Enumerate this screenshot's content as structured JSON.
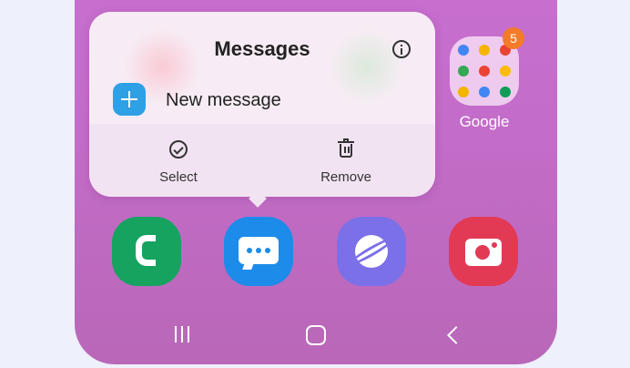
{
  "popup": {
    "title": "Messages",
    "new_message_label": "New message",
    "actions": [
      {
        "label": "Select",
        "icon": "check-circle-icon"
      },
      {
        "label": "Remove",
        "icon": "trash-icon"
      }
    ]
  },
  "google_folder": {
    "label": "Google",
    "badge_count": "5",
    "app_icon_colors": [
      "#4285F4",
      "#F4B400",
      "#EA4335",
      "#34A853",
      "#EA4335",
      "#FBBC05",
      "#F4B400",
      "#4285F4",
      "#0F9D58"
    ]
  },
  "dock": [
    {
      "name": "Phone",
      "icon": "phone-icon",
      "color": "#15a35f"
    },
    {
      "name": "Messages",
      "icon": "messages-icon",
      "color": "#1d8bea"
    },
    {
      "name": "Internet",
      "icon": "internet-icon",
      "color": "#7c70e8"
    },
    {
      "name": "Camera",
      "icon": "camera-icon",
      "color": "#e23a55"
    }
  ],
  "nav": [
    "recent-apps-icon",
    "home-icon",
    "back-icon"
  ]
}
